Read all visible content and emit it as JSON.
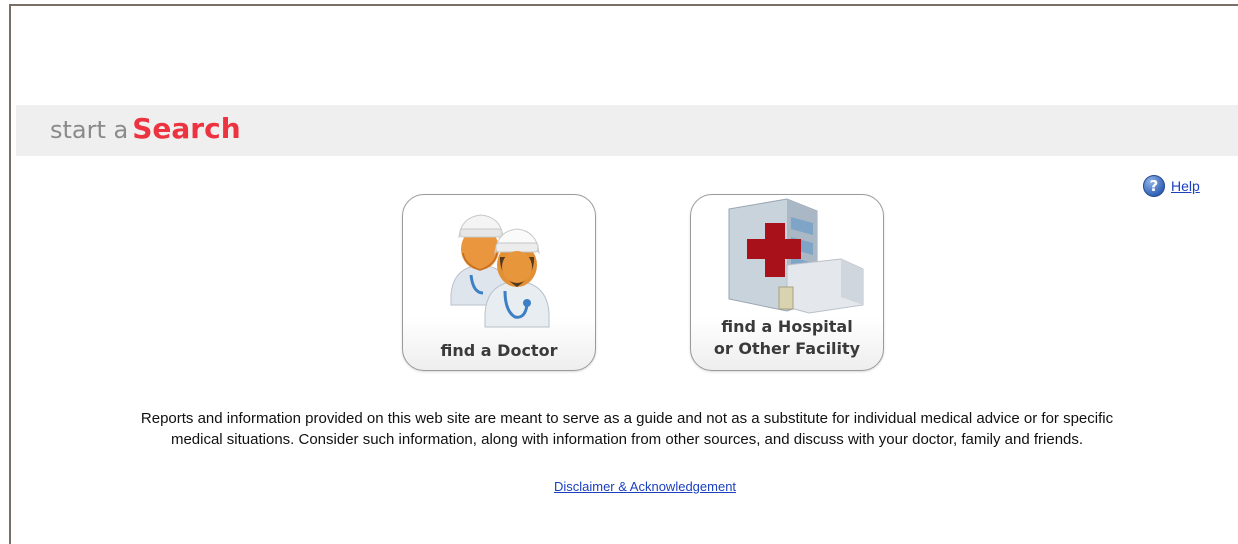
{
  "header": {
    "title_prefix": "start a",
    "title_emphasis": "Search"
  },
  "help": {
    "icon": "question-icon",
    "glyph": "?",
    "label": "Help"
  },
  "tiles": [
    {
      "label": "find a Doctor",
      "icon": "doctors-icon"
    },
    {
      "label_line1": "find a Hospital",
      "label_line2": "or Other Facility",
      "icon": "hospital-icon"
    }
  ],
  "disclaimer": {
    "line1": "Reports and information provided on this web site are meant to serve as a guide and not as a substitute for individual medical advice or for specific",
    "line2": "medical situations. Consider such information, along with information from other sources, and discuss with your doctor, family and friends.",
    "link": "Disclaimer & Acknowledgement"
  },
  "colors": {
    "accent": "#ee3340",
    "link": "#1a3fbf",
    "band": "#efefef"
  }
}
